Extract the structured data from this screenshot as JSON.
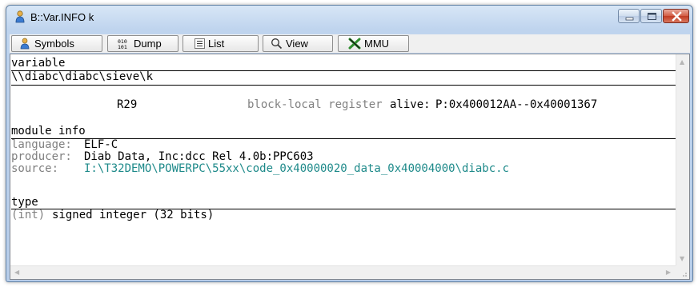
{
  "window": {
    "title": "B::Var.INFO k"
  },
  "toolbar": {
    "symbols": "Symbols",
    "dump": "Dump",
    "list": "List",
    "view": "View",
    "mmu": "MMU"
  },
  "variable": {
    "heading": "variable",
    "path": "\\\\diabc\\diabc\\sieve\\k",
    "register": "R29",
    "scope": "block-local register",
    "alive_label": "alive:",
    "alive_range": "P:0x400012AA--0x40001367"
  },
  "module": {
    "heading": "module info",
    "language_label": "language:",
    "language_value": "ELF-C",
    "producer_label": "producer:",
    "producer_value": "Diab Data, Inc:dcc Rel 4.0b:PPC603",
    "source_label": "source:",
    "source_value": "I:\\T32DEMO\\POWERPC\\55xx\\code_0x40000020_data_0x40004000\\diabc.c"
  },
  "type": {
    "heading": "type",
    "kind": "(int)",
    "description": "signed integer (32 bits)"
  },
  "colors": {
    "teal_source": "#1e8a8a",
    "gray_label": "#808080",
    "close_button": "#c13b23"
  }
}
